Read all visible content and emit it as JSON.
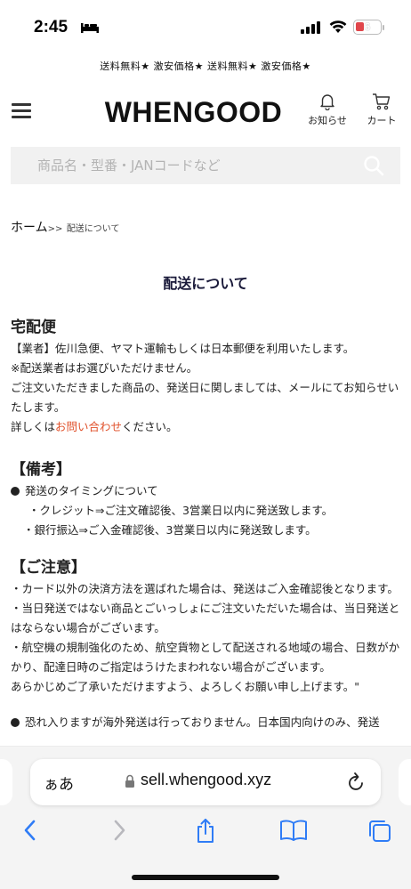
{
  "status": {
    "time": "2:45",
    "battery": "6"
  },
  "promo": {
    "text": "送料無料★ 激安価格★ 送料無料★ 激安価格★"
  },
  "header": {
    "logo": "WHENGOOD",
    "notice_label": "お知らせ",
    "cart_label": "カート"
  },
  "search": {
    "placeholder": "商品名・型番・JANコードなど"
  },
  "breadcrumb": {
    "home": "ホーム",
    "sep": ">>",
    "current": "配送について"
  },
  "page": {
    "title": "配送について"
  },
  "delivery": {
    "title": "宅配便",
    "line1": "【業者】佐川急便、ヤマト運輸もしくは日本郵便を利用いたします。",
    "line2": "※配送業者はお選びいただけません。",
    "line3": "ご注文いただきました商品の、発送日に関しましては、メールにてお知らせいたします。",
    "line4_pre": "詳しくは",
    "line4_link": "お問い合わせ",
    "line4_post": "ください。"
  },
  "remarks": {
    "title": "【備考】",
    "bullet": "発送のタイミングについて",
    "credit": "・クレジット⇒ご注文確認後、3営業日以内に発送致します。",
    "bank": "・銀行振込⇒ご入金確認後、3営業日以内に発送致します。"
  },
  "caution": {
    "title": "【ご注意】",
    "line1": "・カード以外の決済方法を選ばれた場合は、発送はご入金確認後となります。",
    "line2": "・当日発送ではない商品とごいっしょにご注文いただいた場合は、当日発送とはならない場合がございます。",
    "line3": "・航空機の規制強化のため、航空貨物として配送される地域の場合、日数がかかり、配達日時のご指定はうけたまわれない場合がございます。",
    "line4": "あらかじめご了承いただけますよう、よろしくお願い申し上げます。\"",
    "bullet2": "恐れ入りますが海外発送は行っておりません。日本国内向けのみ、発送"
  },
  "browser": {
    "aa": "ぁあ",
    "url": "sell.whengood.xyz"
  }
}
